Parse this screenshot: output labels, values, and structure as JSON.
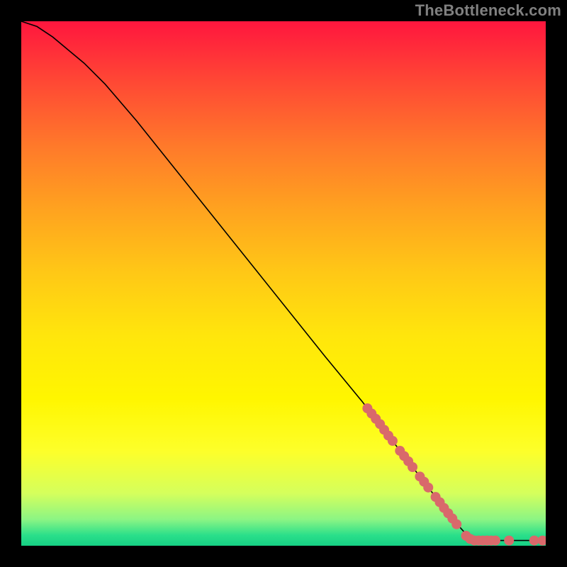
{
  "watermark": "TheBottleneck.com",
  "colors": {
    "curve": "#000000",
    "dot": "#d9696b"
  },
  "chart_data": {
    "type": "line",
    "title": "",
    "xlabel": "",
    "ylabel": "",
    "xlim": [
      0,
      100
    ],
    "ylim": [
      0,
      100
    ],
    "curve": [
      {
        "x": 0,
        "y": 100
      },
      {
        "x": 3,
        "y": 99
      },
      {
        "x": 6,
        "y": 97
      },
      {
        "x": 9,
        "y": 94.5
      },
      {
        "x": 12,
        "y": 92
      },
      {
        "x": 16,
        "y": 88
      },
      {
        "x": 22,
        "y": 81
      },
      {
        "x": 30,
        "y": 71
      },
      {
        "x": 40,
        "y": 58.5
      },
      {
        "x": 50,
        "y": 46
      },
      {
        "x": 58,
        "y": 36
      },
      {
        "x": 65,
        "y": 27.5
      },
      {
        "x": 70,
        "y": 21
      },
      {
        "x": 75,
        "y": 14.5
      },
      {
        "x": 80,
        "y": 8
      },
      {
        "x": 82.5,
        "y": 4.8
      },
      {
        "x": 85,
        "y": 2
      },
      {
        "x": 86.5,
        "y": 1.2
      },
      {
        "x": 88,
        "y": 1
      },
      {
        "x": 92,
        "y": 1
      },
      {
        "x": 96,
        "y": 1
      },
      {
        "x": 100,
        "y": 1
      }
    ],
    "points": [
      {
        "x": 66,
        "y": 26.2
      },
      {
        "x": 66.8,
        "y": 25.2
      },
      {
        "x": 67.6,
        "y": 24.2
      },
      {
        "x": 68.4,
        "y": 23.2
      },
      {
        "x": 69.2,
        "y": 22.1
      },
      {
        "x": 70.0,
        "y": 21.0
      },
      {
        "x": 70.8,
        "y": 20.0
      },
      {
        "x": 72.2,
        "y": 18.1
      },
      {
        "x": 73.0,
        "y": 17.1
      },
      {
        "x": 73.8,
        "y": 16.1
      },
      {
        "x": 74.6,
        "y": 15.0
      },
      {
        "x": 76.0,
        "y": 13.2
      },
      {
        "x": 76.8,
        "y": 12.2
      },
      {
        "x": 77.6,
        "y": 11.1
      },
      {
        "x": 79.0,
        "y": 9.3
      },
      {
        "x": 79.8,
        "y": 8.3
      },
      {
        "x": 80.6,
        "y": 7.2
      },
      {
        "x": 81.4,
        "y": 6.2
      },
      {
        "x": 82.2,
        "y": 5.2
      },
      {
        "x": 83.0,
        "y": 4.1
      },
      {
        "x": 84.8,
        "y": 1.9
      },
      {
        "x": 85.6,
        "y": 1.3
      },
      {
        "x": 86.4,
        "y": 1.0
      },
      {
        "x": 87.2,
        "y": 1.0
      },
      {
        "x": 88.0,
        "y": 1.0
      },
      {
        "x": 88.8,
        "y": 1.0
      },
      {
        "x": 89.6,
        "y": 1.0
      },
      {
        "x": 90.4,
        "y": 1.0
      },
      {
        "x": 93.0,
        "y": 1.0
      },
      {
        "x": 97.8,
        "y": 1.0
      },
      {
        "x": 99.4,
        "y": 1.0
      }
    ],
    "dot_radius_px": 7
  }
}
